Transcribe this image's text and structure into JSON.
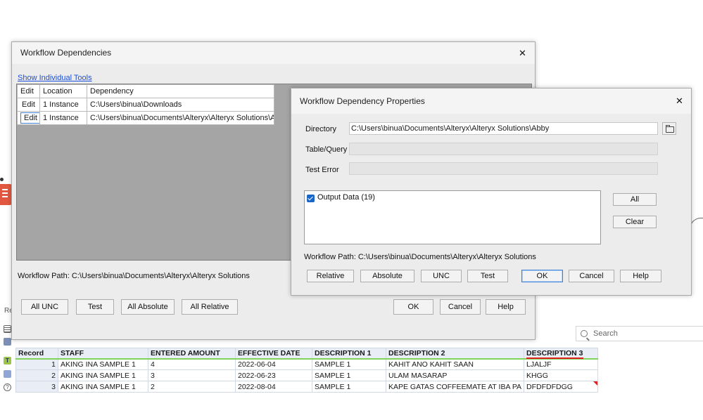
{
  "results": {
    "tab_label": "Re",
    "search_placeholder": "Search",
    "columns": [
      "Record",
      "STAFF",
      "ENTERED AMOUNT",
      "EFFECTIVE DATE",
      "DESCRIPTION 1",
      "DESCRIPTION 2",
      "DESCRIPTION 3"
    ],
    "rows": [
      [
        "1",
        "AKING INA SAMPLE 1",
        "4",
        "2022-06-04",
        "SAMPLE 1",
        "KAHIT ANO KAHIT SAAN",
        "LJALJF"
      ],
      [
        "2",
        "AKING INA SAMPLE 1",
        "3",
        "2022-06-23",
        "SAMPLE 1",
        "ULAM MASARAP",
        "KHGG"
      ],
      [
        "3",
        "AKING INA SAMPLE 1",
        "2",
        "2022-08-04",
        "SAMPLE 1",
        "KAPE GATAS COFFEEMATE AT IBA PA",
        "DFDFDFDGG"
      ]
    ]
  },
  "workflow_dependencies": {
    "title": "Workflow Dependencies",
    "close": "✕",
    "show_tools_link": "Show Individual Tools",
    "columns": [
      "Edit",
      "Location",
      "Dependency"
    ],
    "rows": [
      {
        "edit": "Edit",
        "location": "1 Instance",
        "dependency": "C:\\Users\\binua\\Downloads"
      },
      {
        "edit": "Edit",
        "location": "1 Instance",
        "dependency": "C:\\Users\\binua\\Documents\\Alteryx\\Alteryx Solutions\\Abby"
      }
    ],
    "workflow_path": "Workflow Path: C:\\Users\\binua\\Documents\\Alteryx\\Alteryx Solutions",
    "buttons": {
      "all_unc": "All UNC",
      "test": "Test",
      "all_absolute": "All Absolute",
      "all_relative": "All Relative",
      "ok": "OK",
      "cancel": "Cancel",
      "help": "Help"
    }
  },
  "dependency_properties": {
    "title": "Workflow Dependency Properties",
    "close": "✕",
    "directory_label": "Directory",
    "directory_value": "C:\\Users\\binua\\Documents\\Alteryx\\Alteryx Solutions\\Abby",
    "table_query_label": "Table/Query",
    "test_error_label": "Test Error",
    "tools": [
      {
        "label": "Output Data (19)",
        "checked": true
      }
    ],
    "all_button": "All",
    "clear_button": "Clear",
    "workflow_path": "Workflow Path: C:\\Users\\binua\\Documents\\Alteryx\\Alteryx Solutions",
    "buttons": {
      "relative": "Relative",
      "absolute": "Absolute",
      "unc": "UNC",
      "test": "Test",
      "ok": "OK",
      "cancel": "Cancel",
      "help": "Help"
    }
  },
  "colors": {
    "link": "#1e4fd8",
    "focus_border": "#3c7fd6",
    "header_underline": "#7fd35a",
    "error_marker": "#e02020",
    "dialog_bg": "#ececec",
    "grid_area": "#a5a5a5"
  }
}
